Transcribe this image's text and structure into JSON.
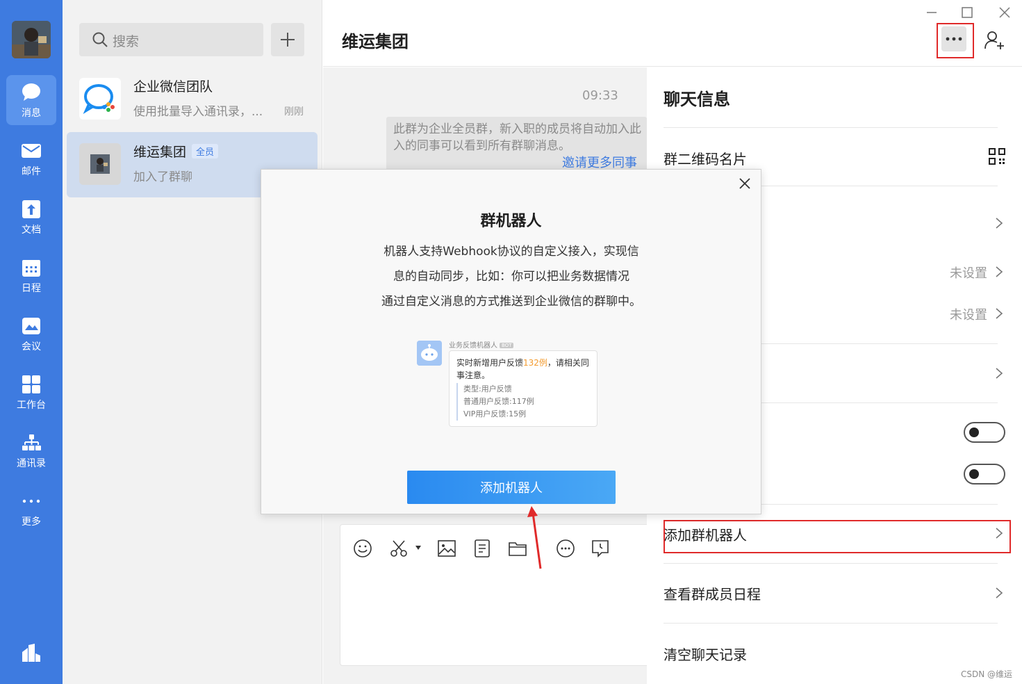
{
  "rail": {
    "items": [
      {
        "label": "消息",
        "icon": "message-icon",
        "active": true
      },
      {
        "label": "邮件",
        "icon": "mail-icon"
      },
      {
        "label": "文档",
        "icon": "document-icon"
      },
      {
        "label": "日程",
        "icon": "calendar-icon"
      },
      {
        "label": "会议",
        "icon": "meeting-icon"
      },
      {
        "label": "工作台",
        "icon": "workbench-icon"
      },
      {
        "label": "通讯录",
        "icon": "contacts-icon"
      },
      {
        "label": "更多",
        "icon": "more-icon"
      }
    ]
  },
  "conv_list": {
    "search_placeholder": "搜索",
    "items": [
      {
        "name": "企业微信团队",
        "preview": "使用批量导入通讯录，...",
        "time": "刚刚"
      },
      {
        "name": "维运集团",
        "badge": "全员",
        "preview": "加入了群聊",
        "active": true
      }
    ]
  },
  "chat": {
    "title": "维运集团",
    "time": "09:33",
    "system_message": {
      "line1": "此群为企业全员群，新入职的成员将自动加入此",
      "line2": "入的同事可以看到所有群聊消息。",
      "invite_link": "邀请更多同事"
    }
  },
  "info_panel": {
    "title": "聊天信息",
    "qr_label": "群二维码名片",
    "value_unset_1": "未设置",
    "value_unset_2": "未设置",
    "add_robot": "添加群机器人",
    "member_schedule": "查看群成员日程",
    "clear_history": "清空聊天记录",
    "watermark": "CSDN @维运"
  },
  "modal": {
    "title": "群机器人",
    "desc_line1": "机器人支持Webhook协议的自定义接入，实现信",
    "desc_line2": "息的自动同步，比如：你可以把业务数据情况",
    "desc_line3": "通过自定义消息的方式推送到企业微信的群聊中。",
    "preview": {
      "bot_name": "业务反馈机器人",
      "bot_tag": "BOT",
      "msg_prefix": "实时新增用户反馈",
      "msg_highlight": "132例",
      "msg_suffix": "，请相关同事注意。",
      "detail_1": "类型:用户反馈",
      "detail_2": "普通用户反馈:117例",
      "detail_3": "VIP用户反馈:15例"
    },
    "button_label": "添加机器人"
  },
  "colors": {
    "rail": "#3e7be0",
    "accent": "#3e7be0",
    "highlight_red": "#e02a2a",
    "primary_button": "#2a8af0"
  }
}
